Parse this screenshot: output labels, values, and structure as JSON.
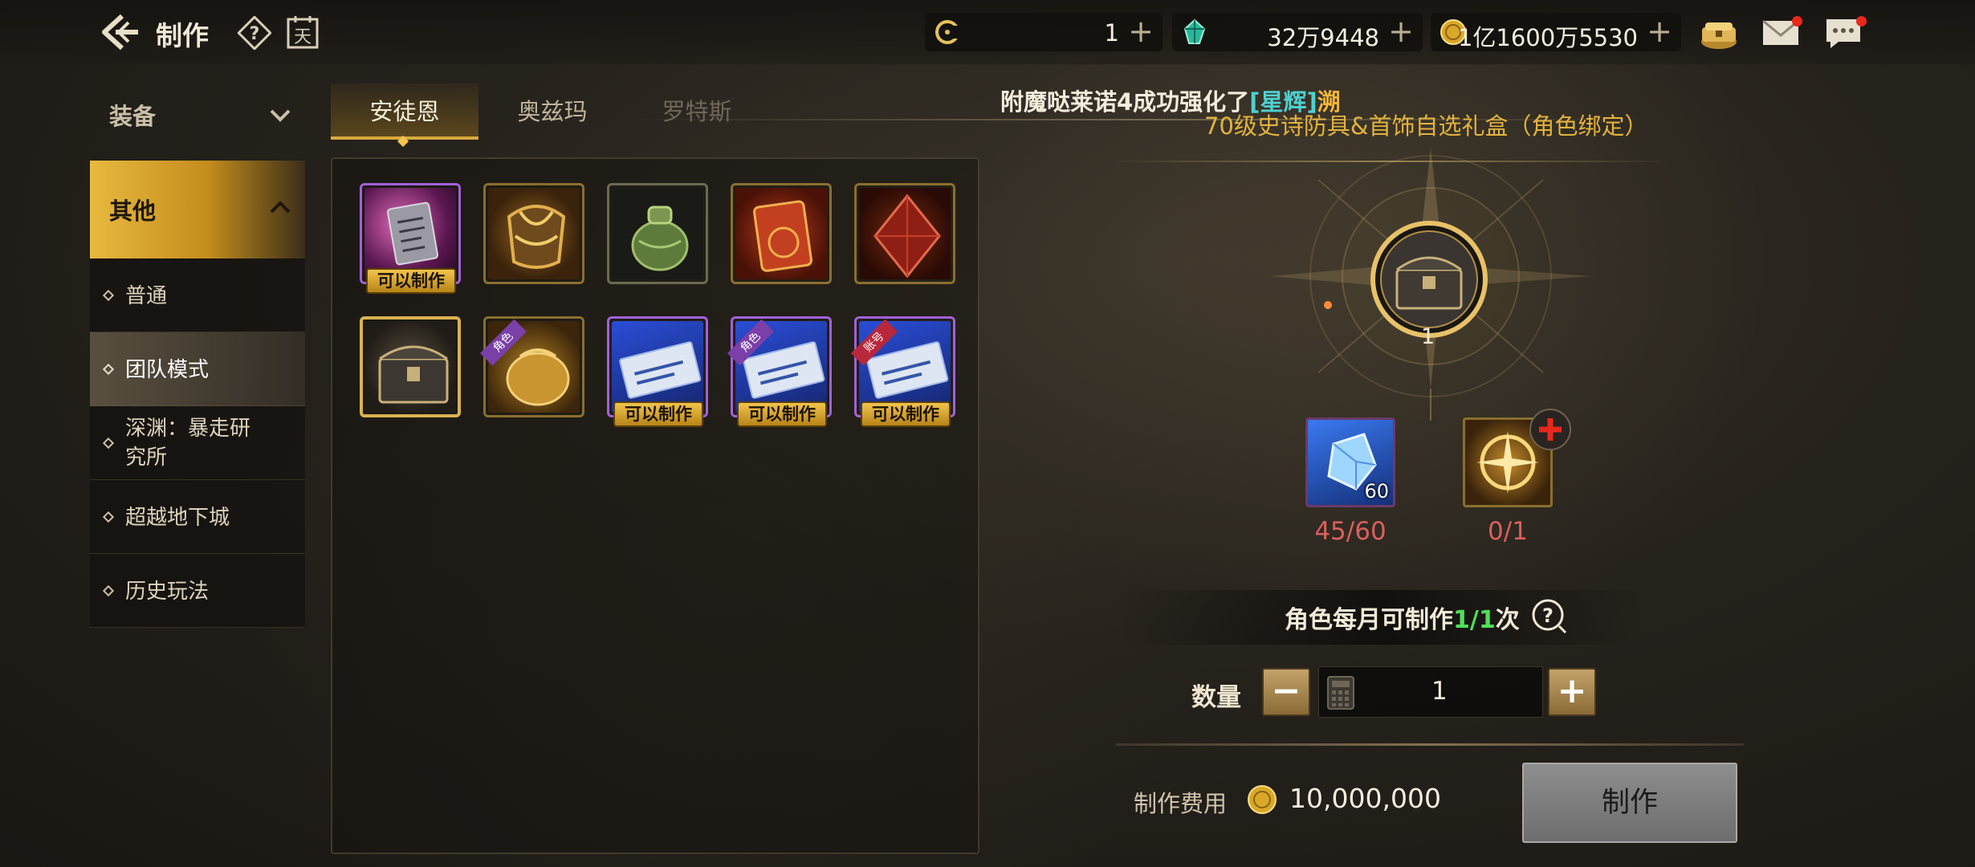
{
  "header": {
    "title": "制作",
    "calendar_glyph": "天",
    "currencies": [
      {
        "icon": "crescent-coin-icon",
        "value": "1"
      },
      {
        "icon": "green-gem-icon",
        "value": "32万9448"
      },
      {
        "icon": "gold-coin-icon",
        "value": "1亿1600万5530"
      }
    ],
    "icons": [
      "treasure-chest-icon",
      "mail-icon",
      "chat-icon"
    ]
  },
  "sidebar": {
    "section_equipment": "装备",
    "section_other": "其他",
    "items": [
      {
        "label": "普通"
      },
      {
        "label": "团队模式"
      },
      {
        "label": "深渊：暴走研究所"
      },
      {
        "label": "超越地下城"
      },
      {
        "label": "历史玩法"
      }
    ]
  },
  "tabs": [
    {
      "label": "安徒恩"
    },
    {
      "label": "奥兹玛"
    },
    {
      "label": "罗特斯"
    }
  ],
  "marquee": {
    "prefix": "附魔哒莱诺4成功强化了",
    "bracket": "[星辉]",
    "suffix": "溯"
  },
  "grid": {
    "can_craft_label": "可以制作",
    "ribbon_role": "角色",
    "ribbon_account": "账号"
  },
  "craft": {
    "item_name": "70级史诗防具&首饰自选礼盒（角色绑定）",
    "item_quantity": "1",
    "materials": [
      {
        "count_badge": "60",
        "progress": "45/60"
      },
      {
        "count_badge": "",
        "progress": "0/1"
      }
    ],
    "monthly_prefix": "角色每月可制作",
    "monthly_count": "1/1",
    "monthly_suffix": "次",
    "quantity_label": "数量",
    "quantity_value": "1",
    "cost_label": "制作费用",
    "cost_value": "10,000,000",
    "craft_button": "制作"
  },
  "colors": {
    "accent_gold": "#e3b33f",
    "active_tab": "#d7a93e",
    "material_shortfall": "#d9605c",
    "monthly_count": "#4fdf5a",
    "highlight_cyan": "#4fd1d0"
  }
}
